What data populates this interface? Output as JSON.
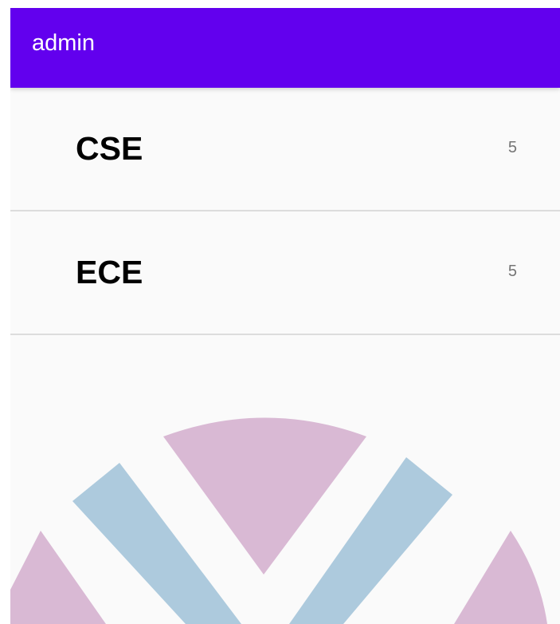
{
  "app_bar": {
    "title": "admin",
    "color": "#6200ee"
  },
  "list": {
    "items": [
      {
        "name": "CSE",
        "count": "5"
      },
      {
        "name": "ECE",
        "count": "5"
      }
    ]
  },
  "watermark": {
    "icon": "college-logo-icon",
    "colors": [
      "#d9b9d4",
      "#adcadd"
    ]
  }
}
